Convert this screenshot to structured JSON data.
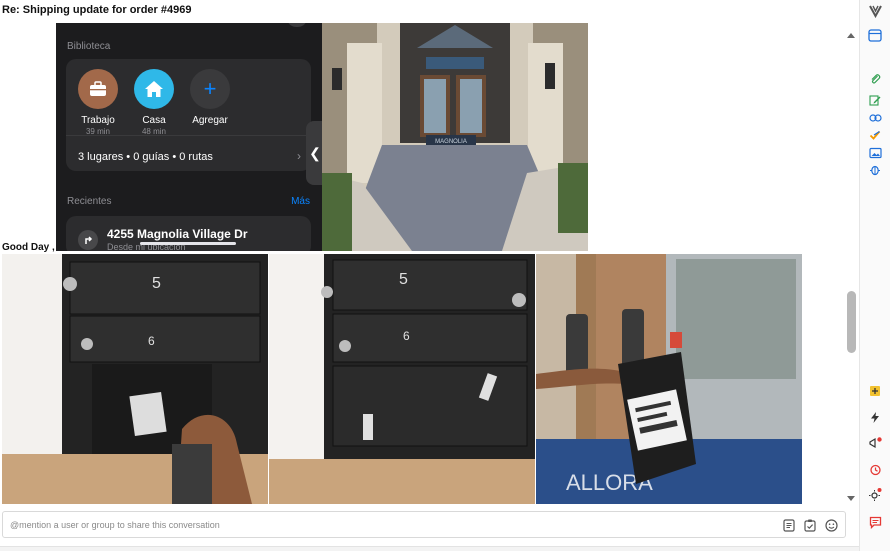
{
  "email": {
    "subject": "Re: Shipping update for order #4969",
    "greeting": "Good Day ,"
  },
  "maps_screenshot": {
    "library_heading": "Biblioteca",
    "favorites": [
      {
        "name": "Trabajo",
        "time": "39 min",
        "icon": "briefcase-icon",
        "color": "#a2694a"
      },
      {
        "name": "Casa",
        "time": "48 min",
        "icon": "house-icon",
        "color": "#2fb8e8"
      },
      {
        "name": "Agregar",
        "time": "",
        "icon": "plus-icon",
        "color": "#3a3a3c"
      }
    ],
    "counts": "3 lugares • 0 guías • 0 rutas",
    "recents_heading": "Recientes",
    "more_link": "Más",
    "recent_item": {
      "title": "4255 Magnolia Village Dr",
      "subtitle": "Desde mi ubicación"
    },
    "entrance_sign": "MAGNOLIA"
  },
  "photos": {
    "mailbox_numbers": [
      "5",
      "6"
    ],
    "door_mat_text": "ALLORA"
  },
  "mention_bar": {
    "placeholder": "@mention a user or group to share this conversation",
    "icons": [
      "template-icon",
      "task-icon",
      "emoji-icon"
    ]
  },
  "rail_icons": [
    "vivaldi-logo-icon",
    "window-icon",
    "attachment-icon",
    "edit-note-icon",
    "link-icon",
    "check-icon",
    "image-icon",
    "bug-icon",
    "add-note-icon",
    "lightning-icon",
    "megaphone-icon",
    "alarm-icon",
    "sun-icon",
    "chat-icon"
  ],
  "colors": {
    "accent_red": "#e53935",
    "accent_green": "#2e9e4f",
    "accent_blue": "#1e6fd9",
    "ios_blue": "#0a84ff"
  }
}
